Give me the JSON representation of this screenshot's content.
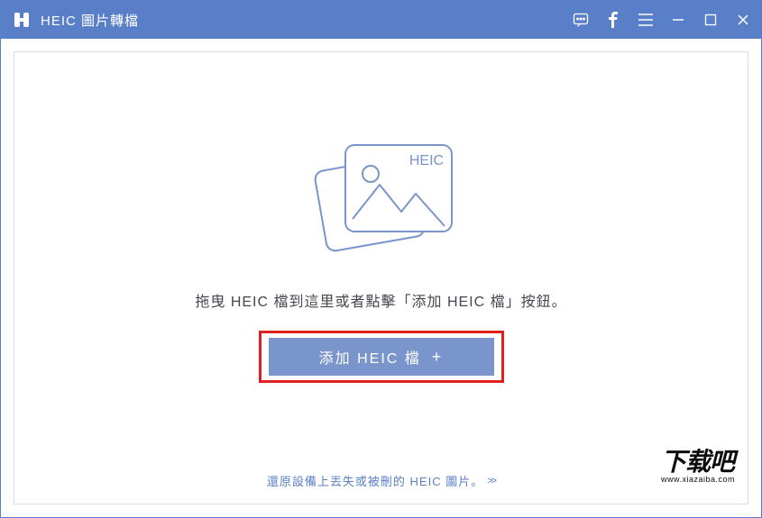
{
  "app": {
    "title": "HEIC 圖片轉檔"
  },
  "illustration": {
    "badge": "HEIC"
  },
  "main": {
    "instruction": "拖曳 HEIC 檔到這里或者點擊「添加 HEIC 檔」按鈕。",
    "add_button_label": "添加 HEIC 檔",
    "add_button_plus": "+"
  },
  "footer": {
    "recover_link": "還原設備上丟失或被刪的 HEIC 圖片。",
    "arrows": ">>"
  },
  "watermark": {
    "big": "下载吧",
    "small": "www.xiazaiba.com"
  },
  "colors": {
    "primary": "#5a7fc9",
    "button": "#7a95cc",
    "highlight": "#e02020"
  }
}
